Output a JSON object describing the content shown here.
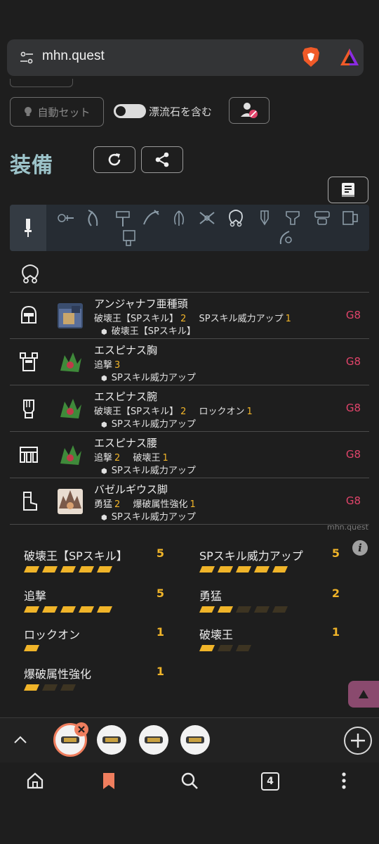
{
  "browser": {
    "url": "mhn.quest",
    "tab_count": "4"
  },
  "controls": {
    "auto_set_label": "自動セット",
    "drift_stone_label": "漂流石を含む",
    "drift_stone_on": true
  },
  "section": {
    "title": "装備"
  },
  "armor": [
    {
      "slot": "head",
      "name": "アンジャナフ亜種頭",
      "skills": [
        {
          "name": "破壊王【SPスキル】",
          "level": "2"
        },
        {
          "name": "SPスキル威力アップ",
          "level": "1"
        }
      ],
      "sp": "破壊王【SPスキル】",
      "grade": "G8",
      "thumb_color": "#3a4d6e"
    },
    {
      "slot": "chest",
      "name": "エスピナス胸",
      "skills": [
        {
          "name": "追撃",
          "level": "3"
        }
      ],
      "sp": "SPスキル威力アップ",
      "grade": "G8",
      "thumb_color": "#3f8a3a"
    },
    {
      "slot": "arms",
      "name": "エスピナス腕",
      "skills": [
        {
          "name": "破壊王【SPスキル】",
          "level": "2"
        },
        {
          "name": "ロックオン",
          "level": "1"
        }
      ],
      "sp": "SPスキル威力アップ",
      "grade": "G8",
      "thumb_color": "#3f8a3a"
    },
    {
      "slot": "waist",
      "name": "エスピナス腰",
      "skills": [
        {
          "name": "追撃",
          "level": "2"
        },
        {
          "name": "破壊王",
          "level": "1"
        }
      ],
      "sp": "SPスキル威力アップ",
      "grade": "G8",
      "thumb_color": "#3f8a3a"
    },
    {
      "slot": "legs",
      "name": "バゼルギウス脚",
      "skills": [
        {
          "name": "勇猛",
          "level": "2"
        },
        {
          "name": "爆破属性強化",
          "level": "1"
        }
      ],
      "sp": "SPスキル威力アップ",
      "grade": "G8",
      "thumb_color": "#7a5a4a"
    }
  ],
  "watermark": "mhn.quest",
  "skill_summary": [
    {
      "name": "破壊王【SPスキル】",
      "level": "5",
      "value": 5,
      "max": 5
    },
    {
      "name": "SPスキル威力アップ",
      "level": "5",
      "value": 5,
      "max": 5
    },
    {
      "name": "追撃",
      "level": "5",
      "value": 5,
      "max": 5
    },
    {
      "name": "勇猛",
      "level": "2",
      "value": 2,
      "max": 5
    },
    {
      "name": "ロックオン",
      "level": "1",
      "value": 1,
      "max": 1
    },
    {
      "name": "破壊王",
      "level": "1",
      "value": 1,
      "max": 3
    },
    {
      "name": "爆破属性強化",
      "level": "1",
      "value": 1,
      "max": 3
    }
  ],
  "colors": {
    "accent_title": "#9cc3c9",
    "level": "#f0b429",
    "grade": "#e0446a",
    "bar_filled": "#f0b429",
    "bar_empty": "#3d3422",
    "tab_active": "#ef7e5e"
  }
}
